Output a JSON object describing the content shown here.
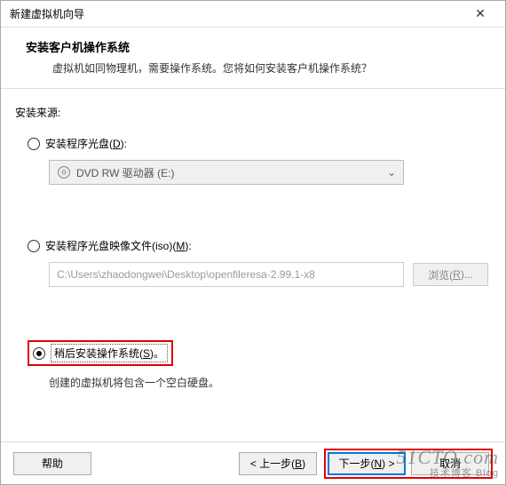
{
  "titlebar": {
    "title": "新建虚拟机向导",
    "close": "✕"
  },
  "header": {
    "title": "安装客户机操作系统",
    "desc": "虚拟机如同物理机，需要操作系统。您将如何安装客户机操作系统？"
  },
  "source_label": "安装来源:",
  "options": {
    "disc": {
      "label_prefix": "安装程序光盘(",
      "label_key": "D",
      "label_suffix": "):",
      "drive_text": "DVD RW 驱动器 (E:)"
    },
    "iso": {
      "label_prefix": "安装程序光盘映像文件(iso)(",
      "label_key": "M",
      "label_suffix": "):",
      "path": "C:\\Users\\zhaodongwei\\Desktop\\openfileresa-2.99.1-x8",
      "browse_prefix": "浏览(",
      "browse_key": "R",
      "browse_suffix": ")..."
    },
    "later": {
      "label_prefix": "稍后安装操作系统(",
      "label_key": "S",
      "label_suffix": ")。",
      "desc": "创建的虚拟机将包含一个空白硬盘。"
    }
  },
  "footer": {
    "help": "帮助",
    "back_prefix": "< 上一步(",
    "back_key": "B",
    "back_suffix": ")",
    "next_prefix": "下一步(",
    "next_key": "N",
    "next_suffix": ") >",
    "cancel": "取消"
  },
  "watermark": {
    "main": "51CTO.com",
    "sub": "技术博客 Blog"
  }
}
